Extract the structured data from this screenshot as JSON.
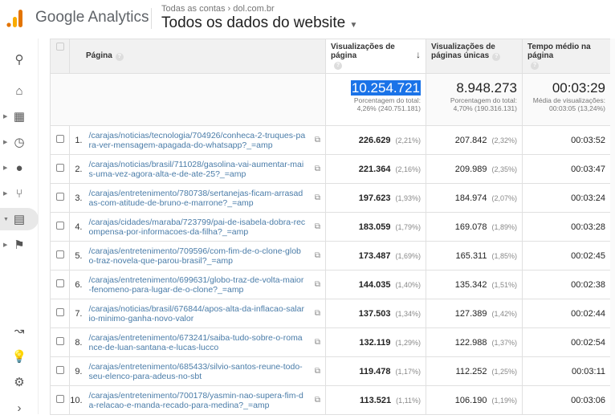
{
  "header": {
    "brand": "Google Analytics",
    "breadcrumb": "Todas as contas › dol.com.br",
    "property": "Todos os dados do website",
    "dropdown_icon": "caret-down"
  },
  "sidebar": {
    "icons": [
      "search-icon",
      "home-icon",
      "dashboard-icon",
      "clock-icon",
      "person-icon",
      "acquisition-icon",
      "behavior-icon",
      "flag-icon",
      "attribution-icon",
      "lightbulb-icon",
      "gear-icon",
      "chevron-right-icon"
    ]
  },
  "table": {
    "columns": {
      "page": "Página",
      "views": "Visualizações de página",
      "unique": "Visualizações de páginas únicas",
      "time": "Tempo médio na página"
    },
    "totals": {
      "views": "10.254.721",
      "views_sub1": "Porcentagem do total:",
      "views_sub2": "4,26% (240.751.181)",
      "unique": "8.948.273",
      "unique_sub1": "Porcentagem do total:",
      "unique_sub2": "4,70% (190.316.131)",
      "time": "00:03:29",
      "time_sub1": "Média de visualizações:",
      "time_sub2": "00:03:05 (13,24%)"
    },
    "rows": [
      {
        "n": "1.",
        "page": "/carajas/noticias/tecnologia/704926/conheca-2-truques-para-ver-mensagem-apagada-do-whatsapp?_=amp",
        "views": "226.629",
        "vp": "(2,21%)",
        "unique": "207.842",
        "up": "(2,32%)",
        "time": "00:03:52"
      },
      {
        "n": "2.",
        "page": "/carajas/noticias/brasil/711028/gasolina-vai-aumentar-mais-uma-vez-agora-alta-e-de-ate-25?_=amp",
        "views": "221.364",
        "vp": "(2,16%)",
        "unique": "209.989",
        "up": "(2,35%)",
        "time": "00:03:47"
      },
      {
        "n": "3.",
        "page": "/carajas/entretenimento/780738/sertanejas-ficam-arrasadas-com-atitude-de-bruno-e-marrone?_=amp",
        "views": "197.623",
        "vp": "(1,93%)",
        "unique": "184.974",
        "up": "(2,07%)",
        "time": "00:03:24"
      },
      {
        "n": "4.",
        "page": "/carajas/cidades/maraba/723799/pai-de-isabela-dobra-recompensa-por-informacoes-da-filha?_=amp",
        "views": "183.059",
        "vp": "(1,79%)",
        "unique": "169.078",
        "up": "(1,89%)",
        "time": "00:03:28"
      },
      {
        "n": "5.",
        "page": "/carajas/entretenimento/709596/com-fim-de-o-clone-globo-traz-novela-que-parou-brasil?_=amp",
        "views": "173.487",
        "vp": "(1,69%)",
        "unique": "165.311",
        "up": "(1,85%)",
        "time": "00:02:45"
      },
      {
        "n": "6.",
        "page": "/carajas/entretenimento/699631/globo-traz-de-volta-maior-fenomeno-para-lugar-de-o-clone?_=amp",
        "views": "144.035",
        "vp": "(1,40%)",
        "unique": "135.342",
        "up": "(1,51%)",
        "time": "00:02:38"
      },
      {
        "n": "7.",
        "page": "/carajas/noticias/brasil/676844/apos-alta-da-inflacao-salario-minimo-ganha-novo-valor",
        "views": "137.503",
        "vp": "(1,34%)",
        "unique": "127.389",
        "up": "(1,42%)",
        "time": "00:02:44"
      },
      {
        "n": "8.",
        "page": "/carajas/entretenimento/673241/saiba-tudo-sobre-o-romance-de-luan-santana-e-lucas-lucco",
        "views": "132.119",
        "vp": "(1,29%)",
        "unique": "122.988",
        "up": "(1,37%)",
        "time": "00:02:54"
      },
      {
        "n": "9.",
        "page": "/carajas/entretenimento/685433/silvio-santos-reune-todo-seu-elenco-para-adeus-no-sbt",
        "views": "119.478",
        "vp": "(1,17%)",
        "unique": "112.252",
        "up": "(1,25%)",
        "time": "00:03:11"
      },
      {
        "n": "10.",
        "page": "/carajas/entretenimento/700178/yasmin-nao-supera-fim-da-relacao-e-manda-recado-para-medina?_=amp",
        "views": "113.521",
        "vp": "(1,11%)",
        "unique": "106.190",
        "up": "(1,19%)",
        "time": "00:03:06"
      }
    ]
  },
  "colors": {
    "accent": "#1a73e8",
    "link": "#4a7ca8",
    "logo_orange": "#f9ab00",
    "logo_dark": "#e37400"
  }
}
